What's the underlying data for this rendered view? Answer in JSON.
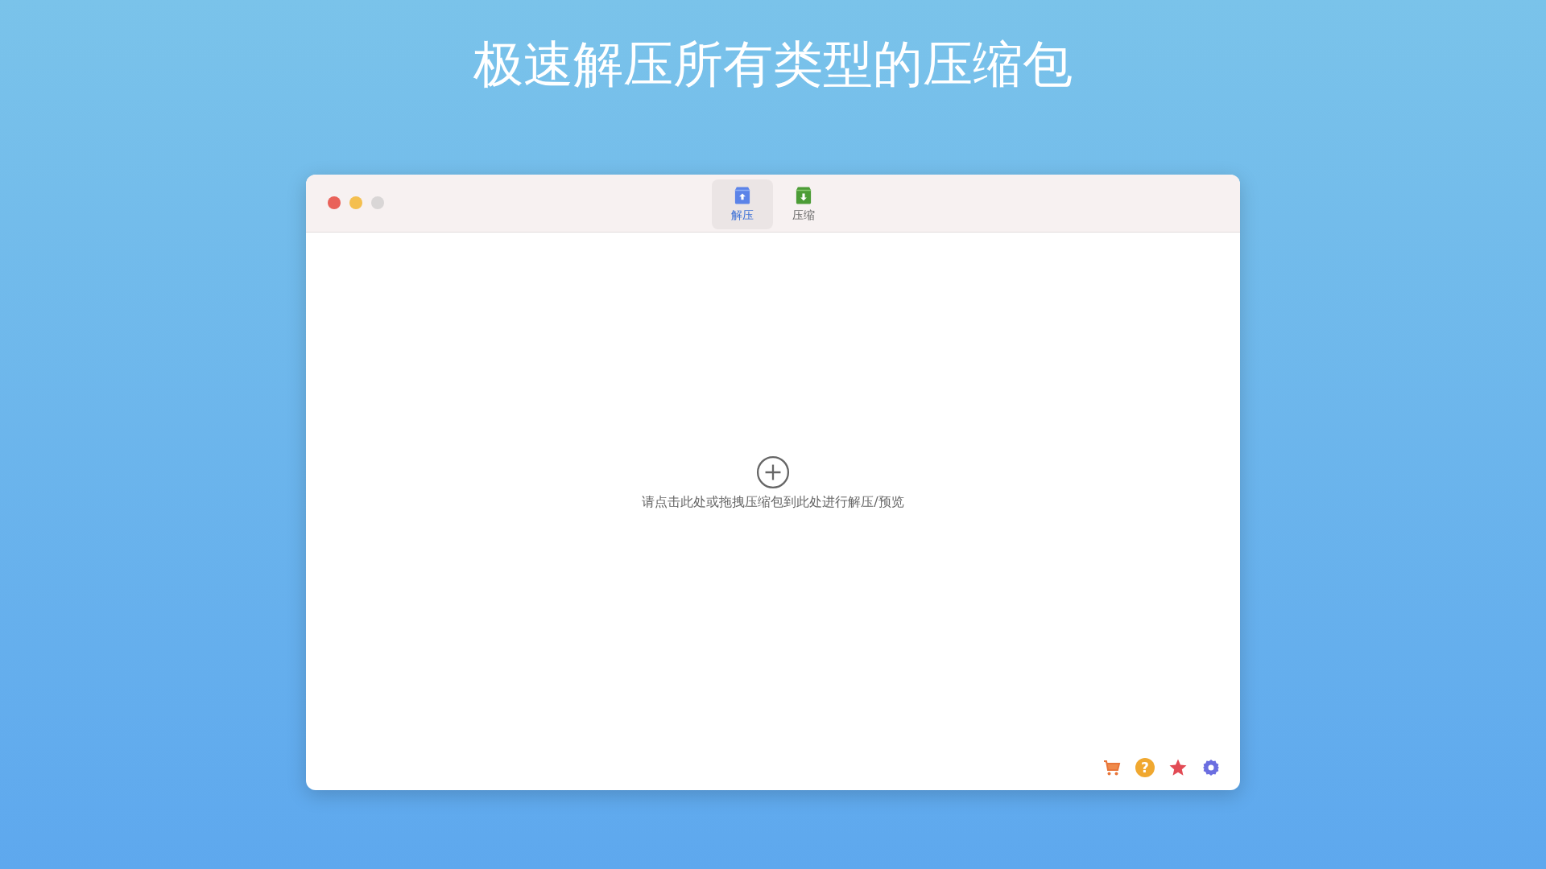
{
  "headline": "极速解压所有类型的压缩包",
  "window": {
    "tabs": [
      {
        "label": "解压",
        "kind": "extract",
        "selected": true
      },
      {
        "label": "压缩",
        "kind": "compress",
        "selected": false
      }
    ],
    "drop_zone": {
      "hint": "请点击此处或拖拽压缩包到此处进行解压/预览"
    },
    "footer": {
      "help_glyph": "?"
    }
  }
}
